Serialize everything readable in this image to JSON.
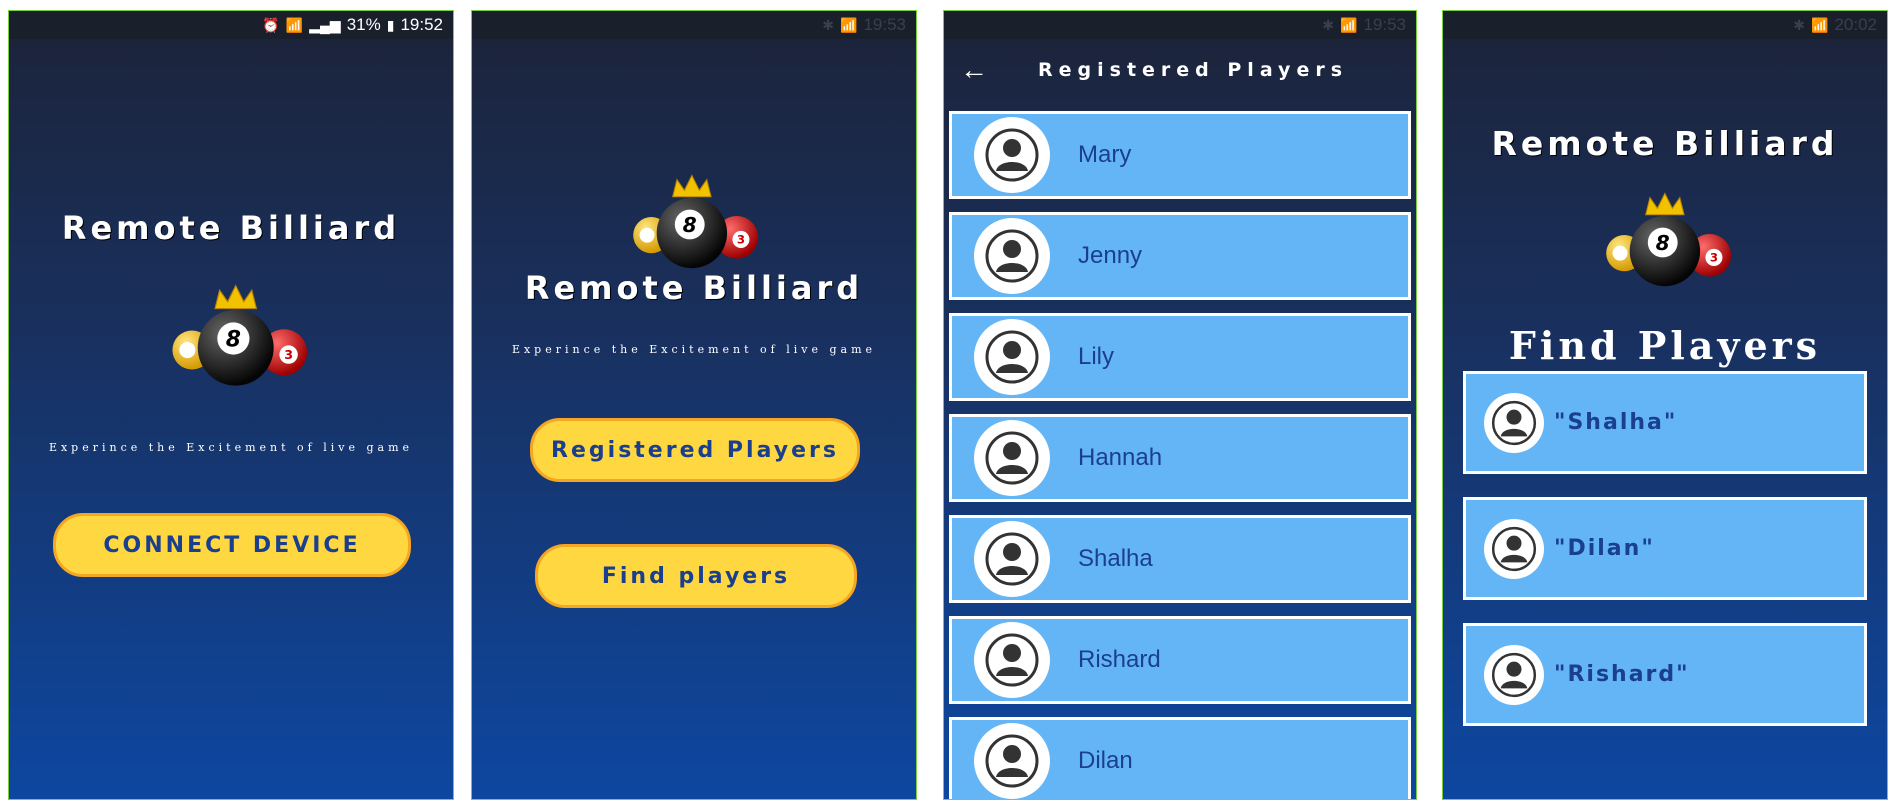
{
  "brand": {
    "title": "Remote Billiard",
    "tagline": "Experince the Excitement of live game"
  },
  "screen1": {
    "status": {
      "battery": "31%",
      "time": "19:52"
    },
    "connect_label": "CONNECT DEVICE"
  },
  "screen2": {
    "status": {
      "time": "19:53"
    },
    "registered_label": "Registered Players",
    "find_label": "Find players"
  },
  "screen3": {
    "status": {
      "time": "19:53"
    },
    "title": "Registered Players",
    "players": [
      "Mary",
      "Jenny",
      "Lily",
      "Hannah",
      "Shalha",
      "Rishard",
      "Dilan"
    ]
  },
  "screen4": {
    "status": {
      "time": "20:02"
    },
    "title": "Find Players",
    "players": [
      "\"Shalha\"",
      "\"Dilan\"",
      "\"Rishard\""
    ]
  },
  "colors": {
    "button_fill": "#ffd740",
    "button_border": "#f5a623",
    "list_row": "#64b5f6",
    "text_dark_blue": "#1a3f8f"
  },
  "icons": [
    "alarm-icon",
    "wifi-icon",
    "signal-icon",
    "battery-icon",
    "bluetooth-icon",
    "back-arrow-icon",
    "person-icon",
    "billiard-logo"
  ]
}
